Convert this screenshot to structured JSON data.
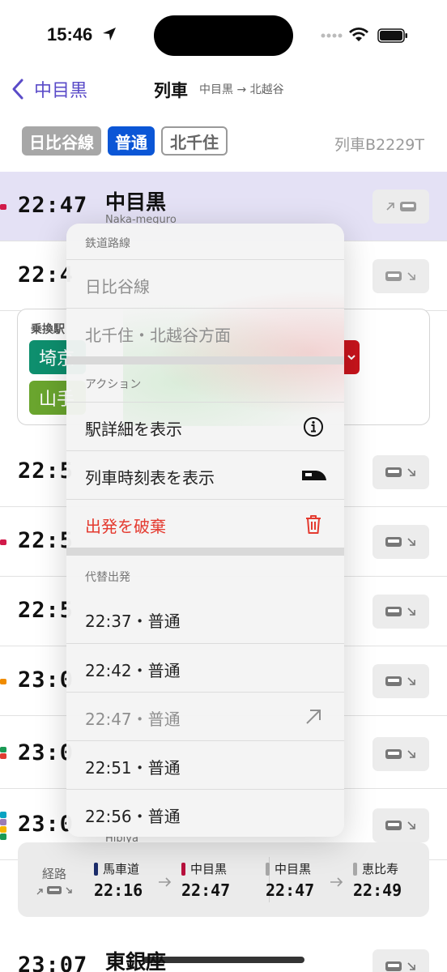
{
  "status": {
    "time": "15:46"
  },
  "nav": {
    "back_label": "中目黒",
    "title": "列車",
    "subtitle": "中目黒 → 北越谷"
  },
  "badges": {
    "line": "日比谷線",
    "type": "普通",
    "dest": "北千住",
    "train_id": "列車B2229T"
  },
  "rows": [
    {
      "time": "22:47",
      "name": "中目黒",
      "roman": "Naka-meguro"
    },
    {
      "time": "22:4"
    },
    {
      "time": "22:5"
    },
    {
      "time": "22:5"
    },
    {
      "time": "22:5"
    },
    {
      "time": "23:0"
    },
    {
      "time": "23:0"
    },
    {
      "time": "23:0",
      "roman": "Hibiya"
    },
    {
      "time": "23:07",
      "name": "東銀座"
    }
  ],
  "transfer": {
    "label": "乗換駅",
    "chip1": "埼京",
    "chip2": "山手"
  },
  "menu": {
    "section1_head": "鉄道路線",
    "line_item": "日比谷線",
    "direction_item": "北千住・北越谷方面",
    "section2_head": "アクション",
    "action_station": "駅詳細を表示",
    "action_timetable": "列車時刻表を表示",
    "action_discard": "出発を破棄",
    "section3_head": "代替出発",
    "alternatives": [
      "22:37・普通",
      "22:42・普通",
      "22:47・普通",
      "22:51・普通",
      "22:56・普通"
    ]
  },
  "route": {
    "label": "経路",
    "seg1": {
      "from": "馬車道",
      "from_time": "22:16",
      "to": "中目黒",
      "to_time": "22:47"
    },
    "seg2": {
      "from": "中目黒",
      "from_time": "22:47",
      "to": "恵比寿",
      "to_time": "22:49"
    }
  },
  "colors": {
    "accent": "#5a4bc8",
    "current_row": "#e4e1f5",
    "danger": "#e43a2f",
    "local_badge": "#0b56d6"
  }
}
